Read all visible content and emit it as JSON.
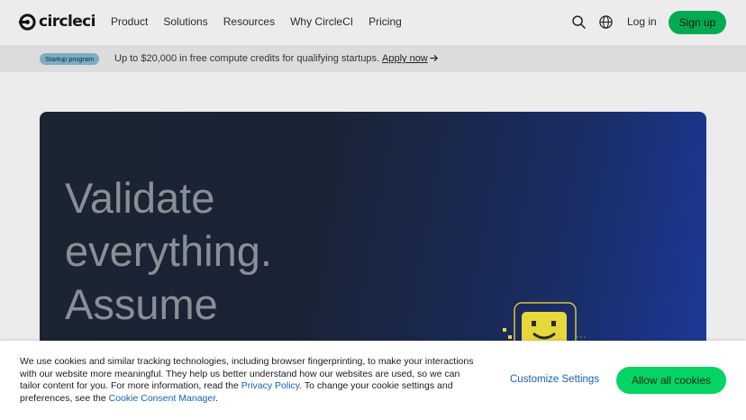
{
  "header": {
    "logo_text": "circleci",
    "nav": [
      "Product",
      "Solutions",
      "Resources",
      "Why CircleCI",
      "Pricing"
    ],
    "login_label": "Log in",
    "signup_label": "Sign up",
    "icons": {
      "search": "search-icon",
      "language": "globe-icon",
      "logo": "circleci-logo-icon"
    }
  },
  "banner": {
    "badge": "Startup program",
    "text": "Up to $20,000 in free compute credits for qualifying startups.",
    "link": "Apply now"
  },
  "hero": {
    "lines": [
      "Validate",
      "everything.",
      "Assume"
    ]
  },
  "cookie": {
    "text_1": "We use cookies and similar tracking technologies, including browser fingerprinting, to make your interactions with our website more meaningful. They help us better understand how our websites are used, so we can tailor content for you. For more information, read the ",
    "privacy_link": "Privacy Policy",
    "text_2": ". To change your cookie settings and preferences, see the ",
    "consent_link": "Cookie Consent Manager",
    "text_3": ".",
    "customize_label": "Customize Settings",
    "allow_label": "Allow all cookies"
  },
  "colors": {
    "brand_green": "#04aa51",
    "cookie_green": "#04d463",
    "link_blue": "#1561b0"
  }
}
